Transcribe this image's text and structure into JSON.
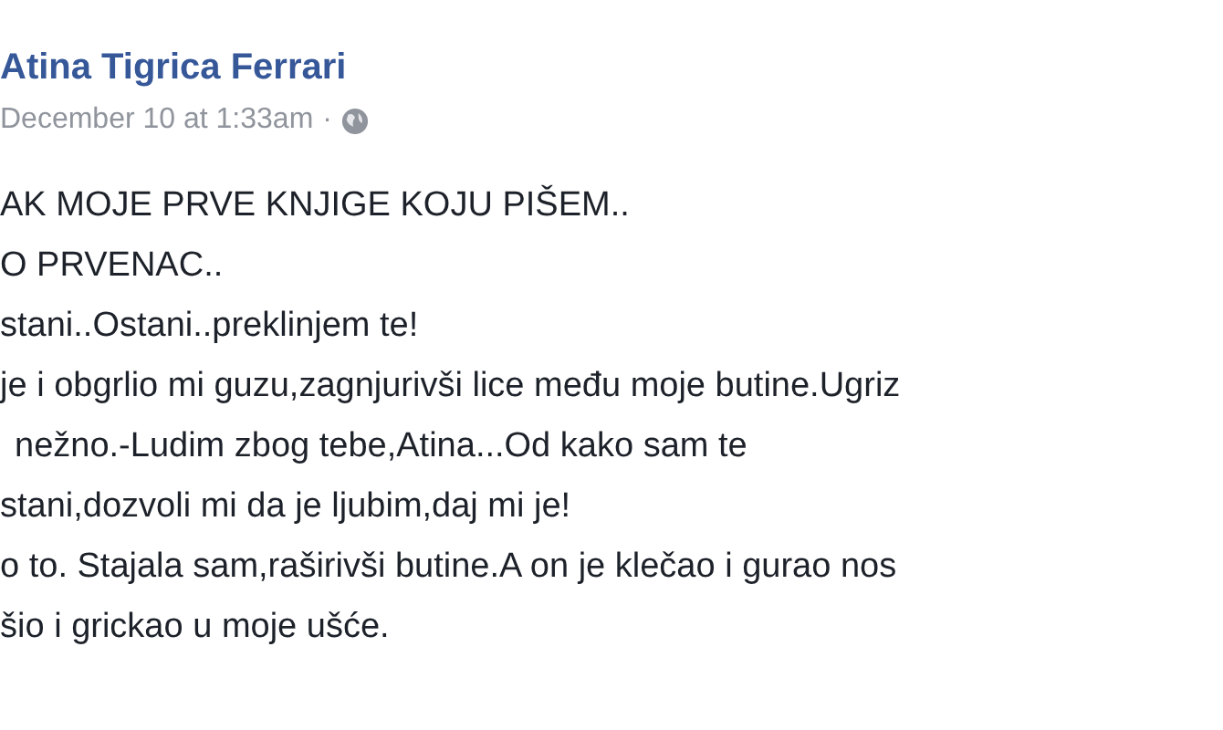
{
  "post": {
    "author": "Atina Tigrica Ferrari",
    "timestamp": "December 10 at 1:33am",
    "separator": "·",
    "lines": [
      "AK MOJE PRVE KNJIGE KOJU PIŠEM..",
      "O PRVENAC..",
      "stani..Ostani..preklinjem te!",
      "je i obgrlio mi guzu,zagnjurivši lice među moje butine.Ugriz",
      "nežno.-Ludim zbog tebe,Atina...Od kako sam te",
      "stani,dozvoli mi da je ljubim,daj mi je!",
      "o to. Stajala sam,raširivši butine.A on je klečao i gurao nos",
      "šio i grickao u moje ušće."
    ]
  }
}
